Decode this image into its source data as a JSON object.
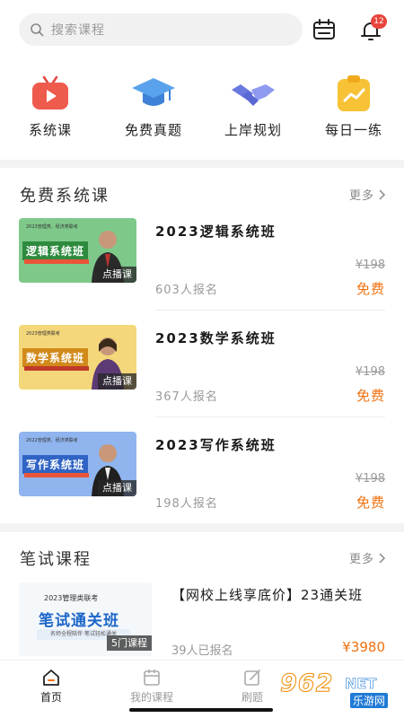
{
  "search": {
    "placeholder": "搜索课程"
  },
  "notifications": {
    "badge_count": "12"
  },
  "quick_links": [
    {
      "label": "系统课",
      "icon": "tv-play-icon"
    },
    {
      "label": "免费真题",
      "icon": "graduation-cap-icon"
    },
    {
      "label": "上岸规划",
      "icon": "handshake-icon"
    },
    {
      "label": "每日一练",
      "icon": "clipboard-trend-icon"
    }
  ],
  "free_section": {
    "title": "免费系统课",
    "more": "更多",
    "courses": [
      {
        "name": "2023逻辑系统班",
        "thumb_title": "逻辑系统班",
        "thumb_header": "2023管理类、经济类联考",
        "tag": "点播课",
        "original_price": "¥198",
        "enrolled": "603人报名",
        "price": "免费",
        "thumb_color": "#7ec98a",
        "title_bg": "#2e8b3e"
      },
      {
        "name": "2023数学系统班",
        "thumb_title": "数学系统班",
        "thumb_header": "2023管理类联考",
        "tag": "点播课",
        "original_price": "¥198",
        "enrolled": "367人报名",
        "price": "免费",
        "thumb_color": "#f4d77a",
        "title_bg": "#d18a1a"
      },
      {
        "name": "2023写作系统班",
        "thumb_title": "写作系统班",
        "thumb_header": "2022管理类、经济类联考",
        "tag": "点播课",
        "original_price": "¥198",
        "enrolled": "198人报名",
        "price": "免费",
        "thumb_color": "#8fb4ee",
        "title_bg": "#2f63c4"
      }
    ]
  },
  "written_section": {
    "title": "笔试课程",
    "more": "更多",
    "course": {
      "thumb_header": "2023管理类联考",
      "thumb_title": "笔试通关班",
      "thumb_sub": "名师全程陪伴·笔试轻松通关",
      "tag": "5门课程",
      "name": "【网校上线享底价】23通关班",
      "enrolled": "39人已报名",
      "price": "¥3980"
    }
  },
  "tabbar": [
    {
      "label": "首页",
      "icon": "home-icon",
      "active": true
    },
    {
      "label": "我的课程",
      "icon": "calendar-icon",
      "active": false
    },
    {
      "label": "刷题",
      "icon": "edit-icon",
      "active": false
    }
  ],
  "watermark": {
    "num": "962",
    "net": "NET",
    "site": "乐游网"
  },
  "colors": {
    "accent": "#f0700e",
    "badge": "#e8453c"
  }
}
